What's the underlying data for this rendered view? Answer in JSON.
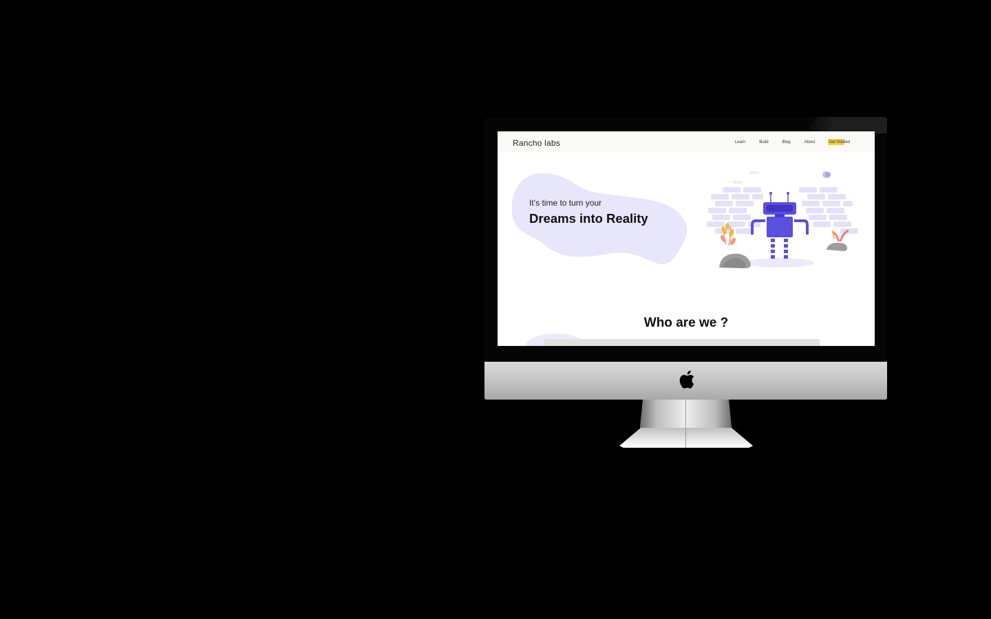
{
  "site": {
    "brand": "Rancho labs",
    "nav": {
      "learn": "Learn",
      "build": "Build",
      "blog": "Blog",
      "about": "About",
      "get_started": "Get Started"
    },
    "hero": {
      "kicker": "It’s time to turn your",
      "title": "Dreams into Reality"
    },
    "section": {
      "title": "Who are we ?"
    }
  },
  "colors": {
    "accent_purple": "#5b4fe0",
    "blob_lavender": "#e8e6fa",
    "cta_yellow": "#f6cf4a",
    "navbar_bg": "#fbfaf7"
  },
  "icons": {
    "logo": "apple-logo-icon",
    "illustration": "robot-illustration"
  }
}
